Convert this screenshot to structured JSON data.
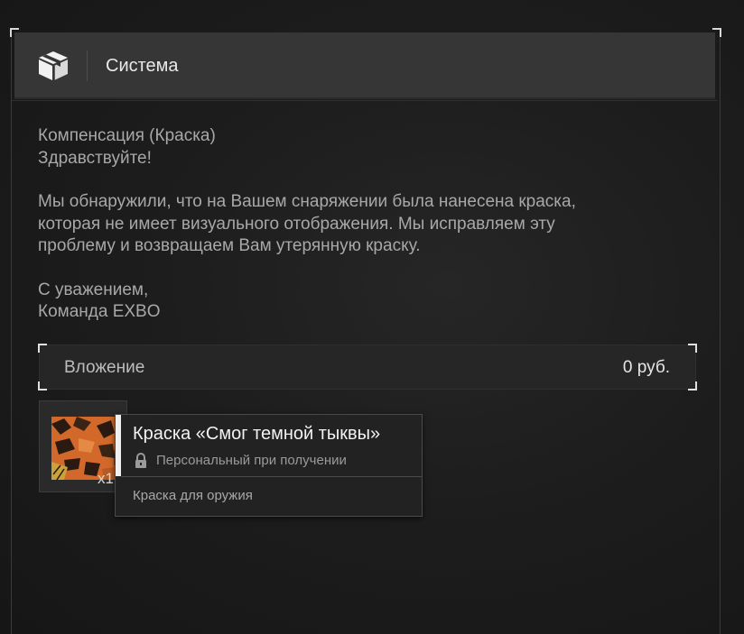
{
  "header": {
    "title": "Система",
    "icon": "package-icon"
  },
  "message": {
    "subject": "Компенсация (Краска)",
    "greeting": "Здравствуйте!",
    "body_line1": "Мы обнаружили, что на Вашем снаряжении была нанесена краска,",
    "body_line2": "которая не имеет визуального отображения. Мы исправляем эту",
    "body_line3": "проблему и возвращаем Вам утерянную краску.",
    "sign_line1": "С уважением,",
    "sign_line2": "Команда EXBO"
  },
  "attachment": {
    "label": "Вложение",
    "price": "0  руб."
  },
  "item": {
    "quantity": "x1",
    "thumbnail_icon": "camo-paint-icon",
    "tooltip": {
      "name": "Краска «Смог темной тыквы»",
      "binding": "Персональный при получении",
      "binding_icon": "lock-icon",
      "type": "Краска для оружия"
    }
  },
  "colors": {
    "camo_orange": "#d2692a",
    "camo_dark": "#2a1a12",
    "camo_yellow": "#c9a23a"
  }
}
